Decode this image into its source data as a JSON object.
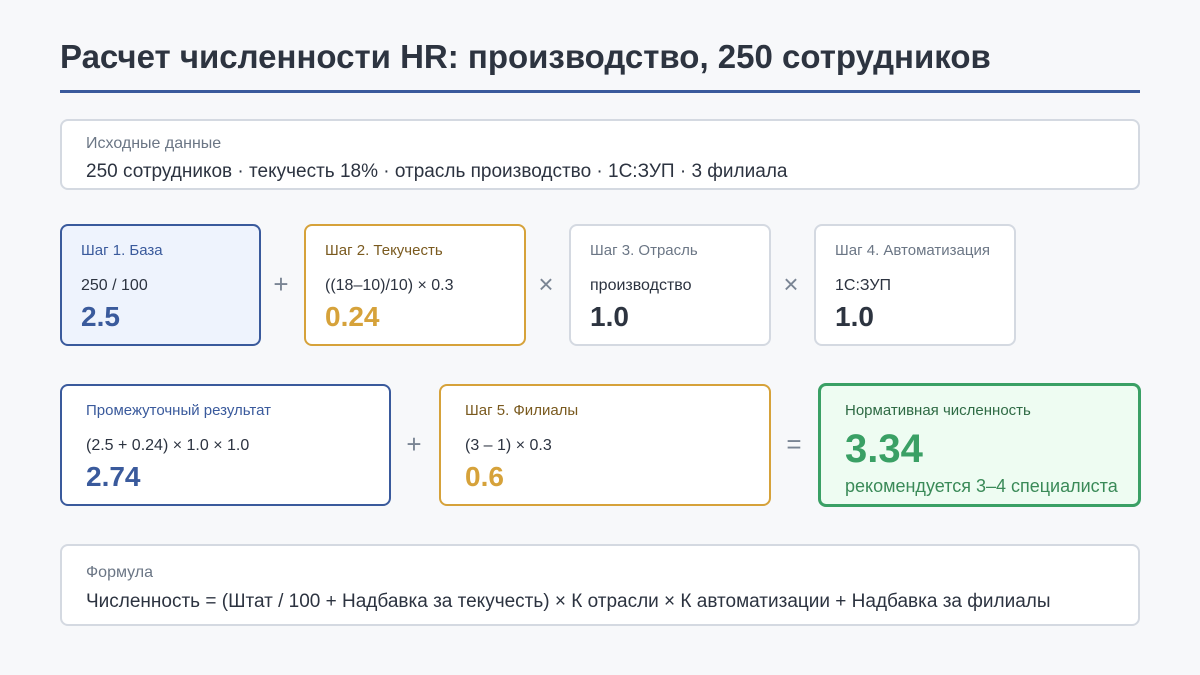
{
  "title": "Расчет численности HR: производство, 250 сотрудников",
  "input": {
    "label": "Исходные данные",
    "text": "250 сотрудников · текучесть 18% · отрасль производство · 1С:ЗУП · 3 филиала"
  },
  "steps": [
    {
      "label": "Шаг 1. База",
      "expr": "250 / 100",
      "value": "2.5"
    },
    {
      "label": "Шаг 2. Текучесть",
      "expr": "((18–10)/10) × 0.3",
      "value": "0.24"
    },
    {
      "label": "Шаг 3. Отрасль",
      "expr": "производство",
      "value": "1.0"
    },
    {
      "label": "Шаг 4. Автоматизация",
      "expr": "1С:ЗУП",
      "value": "1.0"
    }
  ],
  "operators": {
    "plus": "+",
    "times": "×",
    "equals": "="
  },
  "intermediate": {
    "label": "Промежуточный результат",
    "expr": "(2.5 + 0.24) × 1.0 × 1.0",
    "value": "2.74"
  },
  "branches": {
    "label": "Шаг 5. Филиалы",
    "expr": "(3 – 1) × 0.3",
    "value": "0.6"
  },
  "result": {
    "label": "Нормативная численность",
    "value": "3.34",
    "note": "рекомендуется 3–4 специалиста"
  },
  "formula": {
    "label": "Формула",
    "text": "Численность = (Штат / 100 + Надбавка за текучесть) × К отрасли × К автоматизации + Надбавка за филиалы"
  }
}
